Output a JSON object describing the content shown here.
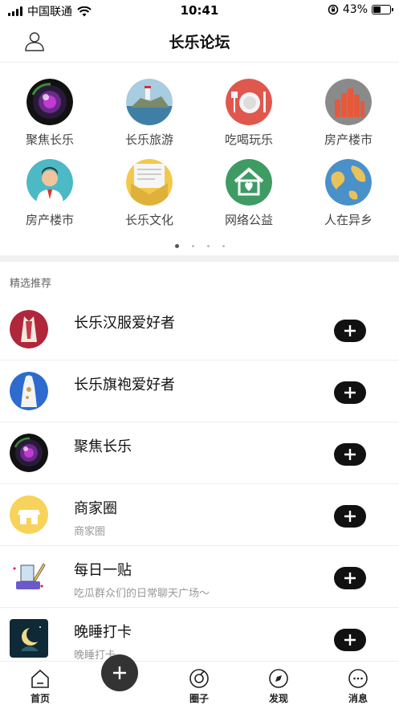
{
  "status_bar": {
    "carrier": "中国联通",
    "time": "10:41",
    "battery": "43%",
    "battery_level": 0.43
  },
  "header": {
    "title": "长乐论坛",
    "user_icon": "user-icon"
  },
  "categories": [
    {
      "label": "聚焦长乐",
      "icon": "camera-lens-icon"
    },
    {
      "label": "长乐旅游",
      "icon": "island-icon"
    },
    {
      "label": "吃喝玩乐",
      "icon": "dining-icon"
    },
    {
      "label": "房产楼市",
      "icon": "buildings-icon"
    },
    {
      "label": "房产楼市",
      "icon": "agent-icon"
    },
    {
      "label": "长乐文化",
      "icon": "document-icon"
    },
    {
      "label": "网络公益",
      "icon": "house-heart-icon"
    },
    {
      "label": "人在异乡",
      "icon": "globe-icon"
    }
  ],
  "pager": {
    "pages": 4,
    "current": 1
  },
  "featured": {
    "title": "精选推荐",
    "items": [
      {
        "title": "长乐汉服爱好者",
        "subtitle": "",
        "avatar": "hanfu-avatar"
      },
      {
        "title": "长乐旗袍爱好者",
        "subtitle": "",
        "avatar": "qipao-avatar"
      },
      {
        "title": "聚焦长乐",
        "subtitle": "",
        "avatar": "camera-lens-avatar"
      },
      {
        "title": "商家圈",
        "subtitle": "商家圈",
        "avatar": "shop-avatar"
      },
      {
        "title": "每日一贴",
        "subtitle": "吃瓜群众们的日常聊天广场～",
        "avatar": "daily-post-avatar"
      },
      {
        "title": "晚睡打卡",
        "subtitle": "晚睡打卡",
        "avatar": "moon-avatar"
      }
    ]
  },
  "tab_bar": [
    {
      "label": "首页",
      "icon": "home-icon",
      "active": true
    },
    {
      "label": "",
      "icon": "plus-icon"
    },
    {
      "label": "圈子",
      "icon": "circle-icon"
    },
    {
      "label": "发现",
      "icon": "discover-icon"
    },
    {
      "label": "消息",
      "icon": "message-icon"
    }
  ],
  "colors": {
    "accent": "#111111",
    "divider": "#f0f0f0",
    "muted": "#999999"
  }
}
